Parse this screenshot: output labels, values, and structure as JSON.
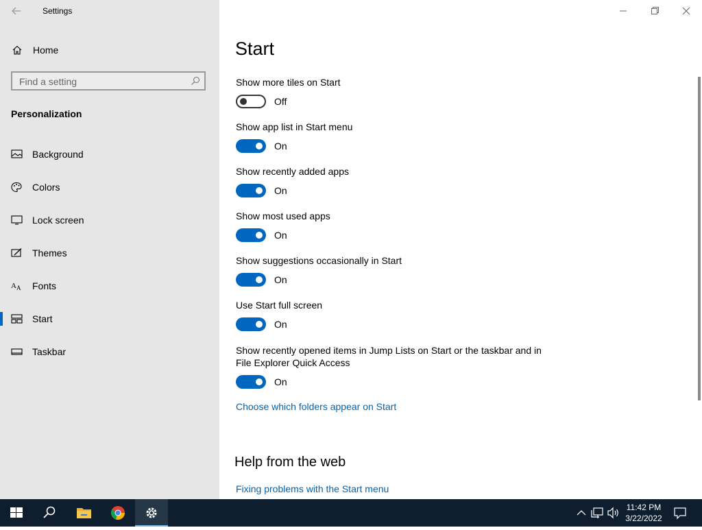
{
  "window": {
    "title": "Settings",
    "back_icon": "back-arrow-icon",
    "controls": [
      "minimize-icon",
      "restore-icon",
      "close-icon"
    ]
  },
  "sidebar": {
    "home_label": "Home",
    "search_placeholder": "Find a setting",
    "section_title": "Personalization",
    "items": [
      {
        "label": "Background",
        "icon": "picture-icon"
      },
      {
        "label": "Colors",
        "icon": "palette-icon"
      },
      {
        "label": "Lock screen",
        "icon": "monitor-icon"
      },
      {
        "label": "Themes",
        "icon": "brush-icon"
      },
      {
        "label": "Fonts",
        "icon": "font-icon"
      },
      {
        "label": "Start",
        "icon": "start-icon",
        "active": true
      },
      {
        "label": "Taskbar",
        "icon": "taskbar-icon"
      }
    ]
  },
  "main": {
    "title": "Start",
    "settings": [
      {
        "title": "Show more tiles on Start",
        "state": "Off"
      },
      {
        "title": "Show app list in Start menu",
        "state": "On"
      },
      {
        "title": "Show recently added apps",
        "state": "On"
      },
      {
        "title": "Show most used apps",
        "state": "On"
      },
      {
        "title": "Show suggestions occasionally in Start",
        "state": "On"
      },
      {
        "title": "Use Start full screen",
        "state": "On"
      },
      {
        "title": "Show recently opened items in Jump Lists on Start or the taskbar and in File Explorer Quick Access",
        "state": "On"
      }
    ],
    "folders_link": "Choose which folders appear on Start",
    "help_title": "Help from the web",
    "help_link": "Fixing problems with the Start menu"
  },
  "taskbar": {
    "apps": [
      "windows-start-icon",
      "search-icon",
      "file-explorer-icon",
      "chrome-icon",
      "settings-gear-icon"
    ],
    "clock_time": "11:42 PM",
    "clock_date": "3/22/2022"
  },
  "colors": {
    "accent": "#0067c0",
    "link": "#0063b1",
    "sidebar_bg": "#e6e6e6",
    "taskbar_bg": "#0f1e2e"
  }
}
